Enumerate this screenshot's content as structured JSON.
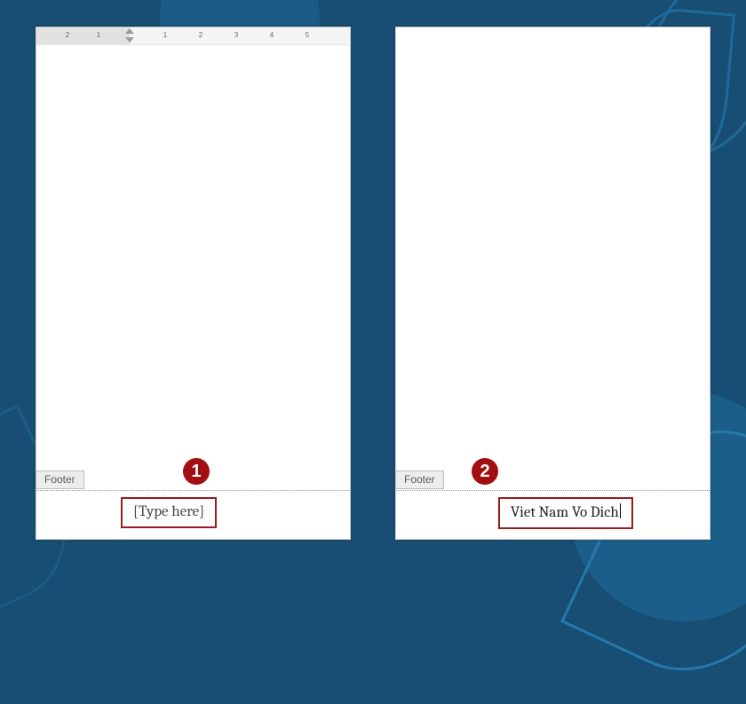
{
  "ruler": {
    "labels": [
      "2",
      "1",
      "1",
      "2",
      "3",
      "4",
      "5"
    ]
  },
  "footer_tab_label": "Footer",
  "badges": {
    "step1": "1",
    "step2": "2"
  },
  "page1": {
    "footer_placeholder": "[Type here]"
  },
  "page2": {
    "footer_text": "Viet Nam Vo Dich"
  }
}
